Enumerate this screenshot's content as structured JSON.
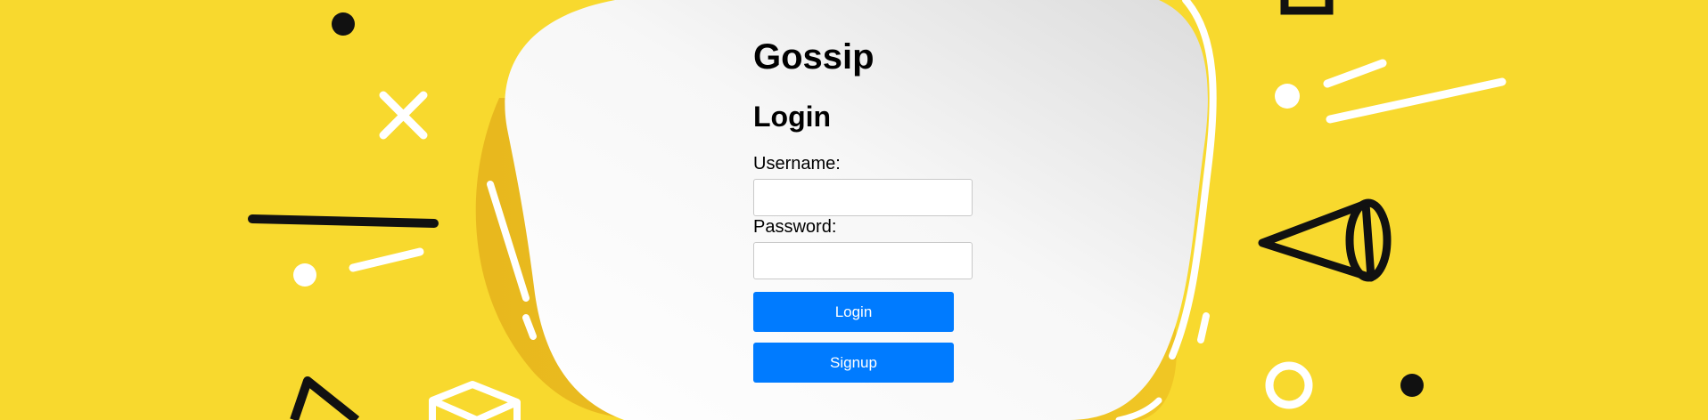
{
  "app": {
    "title": "Gossip"
  },
  "login_form": {
    "heading": "Login",
    "username": {
      "label": "Username:",
      "value": "",
      "placeholder": ""
    },
    "password": {
      "label": "Password:",
      "value": "",
      "placeholder": ""
    },
    "login_button": "Login",
    "signup_button": "Signup"
  },
  "colors": {
    "background": "#f8d92e",
    "bubble": "#ffffff",
    "button": "#007bff",
    "button_text": "#ffffff",
    "accent_dark": "#111111"
  }
}
